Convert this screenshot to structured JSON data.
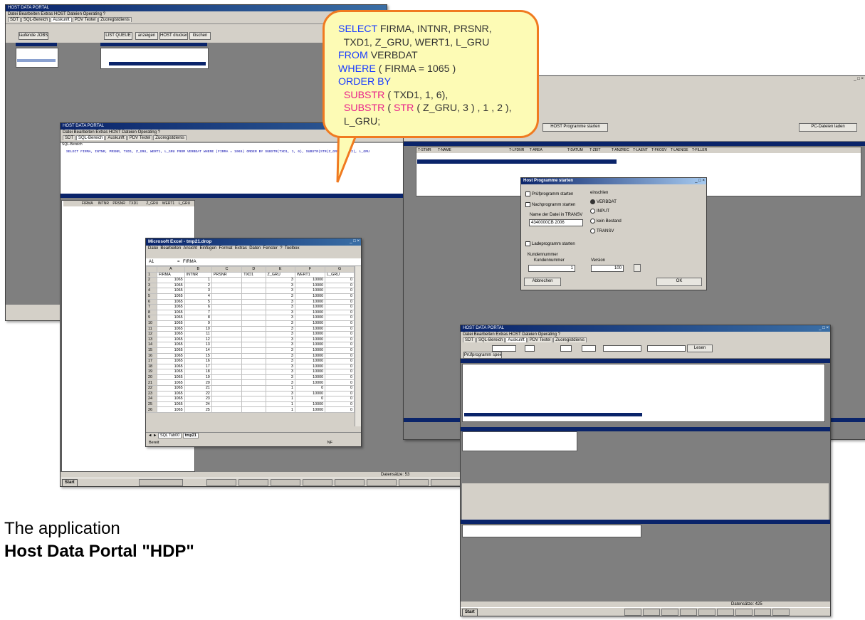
{
  "win_main": {
    "title": "HOST DATA PORTAL",
    "menu": "Datei  Bearbeiten  Extras  HOST Dateien  Operating  ?",
    "tabs": [
      "SDT",
      "SQL-Bereich",
      "Auskunft",
      "PDV Textel",
      "Zuoregistdienis"
    ],
    "buttons": {
      "jobs": "laufende JOBS",
      "list_queue": "LIST QUEUE",
      "anzeigen": "anzeigen",
      "host_drucken": "HOST drucken",
      "loeschen": "löschen"
    }
  },
  "win_sql": {
    "title": "HOST DATA PORTAL",
    "tabs": [
      "SDT",
      "SQL-Bereich",
      "Auskunft",
      "PDV Textel",
      "Zuoregistdienis"
    ],
    "section": "SQL-Bereich",
    "query": "SELECT FIRMA, INTNR, PRSNR, TXD1, Z_GRU, WERT1, L_GRU FROM VERBDAT WHERE (FIRMA = 1065) ORDER BY SUBSTR(TXD1, 1, 6), SUBSTR(STR(Z_GRU,3),1,2), L_GRU",
    "columns": [
      "FIRMA",
      "INTNR",
      "PRSNR",
      "TXD1",
      "Z_GRU",
      "WERT1",
      "L_GRU"
    ],
    "status": "Datensätze: 53"
  },
  "excel": {
    "title": "Microsoft Excel - tmp21.drop",
    "menu": [
      "Datei",
      "Bearbeiten",
      "Ansicht",
      "Einfügen",
      "Format",
      "Extras",
      "Daten",
      "Fenster",
      "?",
      "Toolbox"
    ],
    "cell_ref": "A1",
    "formula": "FIRMA",
    "col_letters": [
      "A",
      "B",
      "C",
      "D",
      "E",
      "F",
      "G"
    ],
    "headers": [
      "FIRMA",
      "INTNR",
      "PRSNR",
      "TXD1",
      "Z_GRU",
      "WERT1",
      "L_GRU"
    ],
    "rows": [
      [
        "1065",
        "1",
        "",
        "",
        "3",
        "10000",
        "0"
      ],
      [
        "1065",
        "2",
        "",
        "",
        "3",
        "10000",
        "0"
      ],
      [
        "1065",
        "3",
        "",
        "",
        "3",
        "10000",
        "0"
      ],
      [
        "1065",
        "4",
        "",
        "",
        "3",
        "10000",
        "0"
      ],
      [
        "1065",
        "5",
        "",
        "",
        "3",
        "10000",
        "0"
      ],
      [
        "1065",
        "6",
        "",
        "",
        "3",
        "10000",
        "0"
      ],
      [
        "1065",
        "7",
        "",
        "",
        "3",
        "10000",
        "0"
      ],
      [
        "1065",
        "8",
        "",
        "",
        "3",
        "10000",
        "0"
      ],
      [
        "1065",
        "9",
        "",
        "",
        "3",
        "10000",
        "0"
      ],
      [
        "1065",
        "10",
        "",
        "",
        "3",
        "10000",
        "0"
      ],
      [
        "1065",
        "11",
        "",
        "",
        "3",
        "10000",
        "0"
      ],
      [
        "1065",
        "12",
        "",
        "",
        "3",
        "10000",
        "0"
      ],
      [
        "1065",
        "13",
        "",
        "",
        "3",
        "10000",
        "0"
      ],
      [
        "1065",
        "14",
        "",
        "",
        "3",
        "10000",
        "0"
      ],
      [
        "1065",
        "15",
        "",
        "",
        "3",
        "10000",
        "0"
      ],
      [
        "1065",
        "16",
        "",
        "",
        "3",
        "10000",
        "0"
      ],
      [
        "1065",
        "17",
        "",
        "",
        "3",
        "10000",
        "0"
      ],
      [
        "1065",
        "18",
        "",
        "",
        "3",
        "10000",
        "0"
      ],
      [
        "1065",
        "19",
        "",
        "",
        "3",
        "10000",
        "0"
      ],
      [
        "1065",
        "20",
        "",
        "",
        "3",
        "10000",
        "0"
      ],
      [
        "1065",
        "21",
        "",
        "",
        "1",
        "0",
        "0"
      ],
      [
        "1065",
        "22",
        "",
        "",
        "3",
        "10000",
        "0"
      ],
      [
        "1065",
        "23",
        "",
        "",
        "1",
        "0",
        "0"
      ],
      [
        "1065",
        "24",
        "",
        "",
        "1",
        "10000",
        "0"
      ],
      [
        "1065",
        "25",
        "",
        "",
        "1",
        "10000",
        "0"
      ]
    ],
    "sheet_tabs": [
      "SQL Tab00",
      "tmp21"
    ],
    "status_left": "Bereit",
    "status_right": "NF"
  },
  "callout": {
    "lines": [
      [
        {
          "t": "SELECT",
          "c": "kw"
        },
        {
          "t": " FIRMA, INTNR, PRSNR,",
          "c": ""
        }
      ],
      [
        {
          "t": "  TXD1, Z_GRU, WERT1, L_GRU",
          "c": ""
        }
      ],
      [
        {
          "t": "FROM",
          "c": "kw"
        },
        {
          "t": " VERBDAT",
          "c": ""
        }
      ],
      [
        {
          "t": "WHERE",
          "c": "kw"
        },
        {
          "t": " ( FIRMA = 1065 )",
          "c": ""
        }
      ],
      [
        {
          "t": "ORDER BY",
          "c": "kw"
        }
      ],
      [
        {
          "t": "  SUBSTR",
          "c": "fn"
        },
        {
          "t": " ( TXD1, 1, 6),",
          "c": ""
        }
      ],
      [
        {
          "t": "  SUBSTR",
          "c": "fn"
        },
        {
          "t": " ( ",
          "c": ""
        },
        {
          "t": "STR",
          "c": "fn"
        },
        {
          "t": " ( Z_GRU, 3 ) , 1 , 2 ),",
          "c": ""
        }
      ],
      [
        {
          "t": "  L_GRU;",
          "c": ""
        }
      ]
    ]
  },
  "win_host": {
    "btn_host": "HOST Programme starten",
    "btn_pc": "PC-Dateien laden",
    "columns": [
      "T-STMR",
      "T-NAME",
      "T-LFDNR",
      "T-AREA",
      "T-DATUM",
      "T-ZEIT",
      "T-ANZREC",
      "T-LAENT",
      "T-FKOSV",
      "T-LAENGE",
      "T-FILLER"
    ]
  },
  "dialog": {
    "title": "Host Programme starten",
    "chk_pruef": "Prüfprogramm starten",
    "chk_nach": "Nachprogramm starten",
    "label_datei": "Name der Datei in TRANSV",
    "datei_value": "4340000CB 2006",
    "chk_lade": "Ladeprogramm starten",
    "group_title": "einschlen",
    "radios": [
      "VERBDAT",
      "INPUT",
      "kein Bestand",
      "TRANSV"
    ],
    "group_kunde": "Kundennummer",
    "kunde_label": "Kundennummer",
    "kunde_value": "1",
    "version_label": "Version",
    "version_value": "100",
    "btn_cancel": "Abbrechen",
    "btn_ok": "OK"
  },
  "win_auskunft": {
    "title": "HOST DATA PORTAL",
    "menu": "Datei  Bearbeiten  Extras  HOST Dateien  Operating  ?",
    "tabs": [
      "SDT",
      "SQL-Bereich",
      "Auskunft",
      "PDV Textel",
      "Zuoregistdienis"
    ],
    "btn_lesen": "Lesen",
    "btn_speichern": "Prüfprogramm speichern",
    "status": "Datensätze: 425"
  },
  "caption": {
    "line1": "The application",
    "line2": "Host Data Portal  \"HDP\""
  }
}
